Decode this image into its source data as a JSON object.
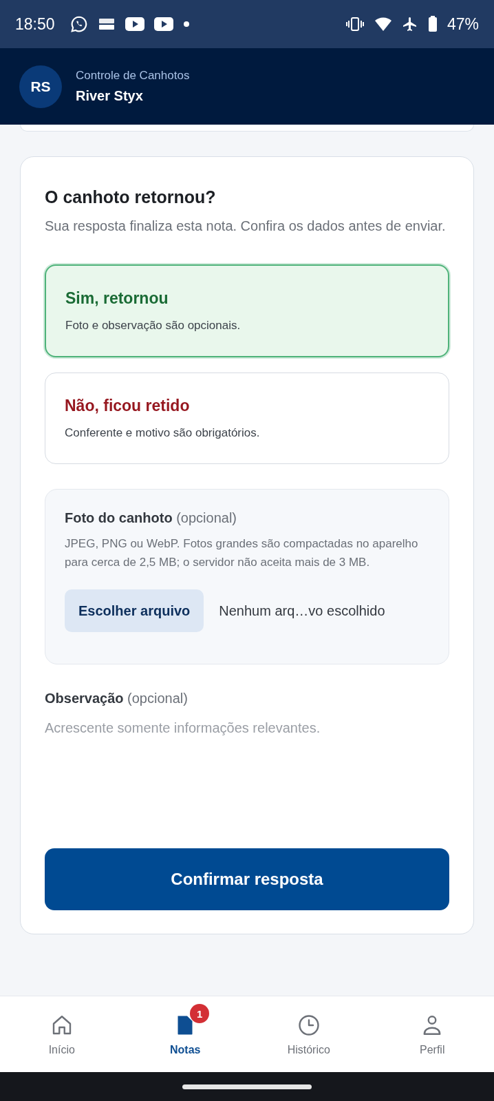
{
  "status_bar": {
    "time": "18:50",
    "battery": "47%"
  },
  "header": {
    "avatar": "RS",
    "subtitle": "Controle de Canhotos",
    "title": "River Styx"
  },
  "question": {
    "title": "O canhoto retornou?",
    "description": "Sua resposta finaliza esta nota. Confira os dados antes de enviar."
  },
  "options": [
    {
      "title": "Sim, retornou",
      "description": "Foto e observação são opcionais.",
      "color": "#1a6b35",
      "selected": true
    },
    {
      "title": "Não, ficou retido",
      "description": "Conferente e motivo são obrigatórios.",
      "color": "#96171f",
      "selected": false
    }
  ],
  "photo": {
    "label": "Foto do canhoto",
    "hint": "(opcional)",
    "description": "JPEG, PNG ou WebP. Fotos grandes são compactadas no aparelho para cerca de 2,5 MB; o servidor não aceita mais de 3 MB.",
    "button": "Escolher arquivo",
    "file_status": "Nenhum arq…vo escolhido"
  },
  "observation": {
    "label": "Observação",
    "hint": "(opcional)",
    "placeholder": "Acrescente somente informações relevantes."
  },
  "submit": "Confirmar resposta",
  "nav": [
    {
      "kind": "home",
      "label": "Início",
      "selected": false
    },
    {
      "kind": "notes",
      "label": "Notas",
      "selected": true,
      "badge": "1"
    },
    {
      "kind": "history",
      "label": "Histórico",
      "selected": false
    },
    {
      "kind": "profile",
      "label": "Perfil",
      "selected": false
    }
  ]
}
